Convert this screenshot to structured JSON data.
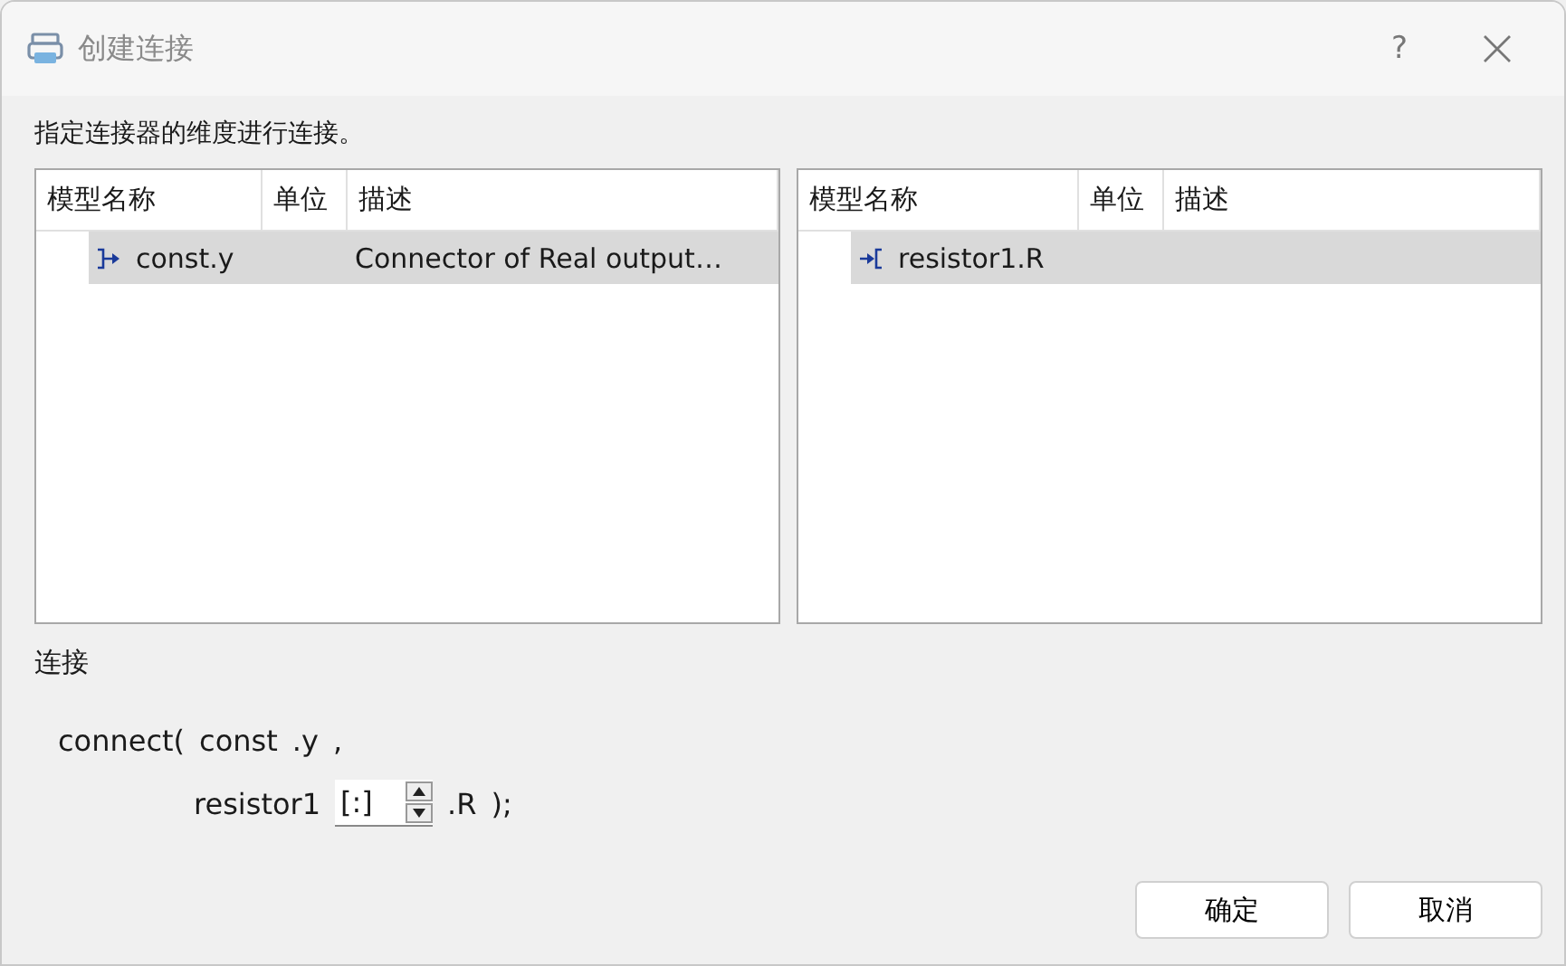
{
  "window": {
    "title": "创建连接",
    "help": "?"
  },
  "instruction": "指定连接器的维度进行连接。",
  "tables": [
    {
      "columns": [
        "模型名称",
        "单位",
        "描述"
      ],
      "rows": [
        {
          "name": "const.y",
          "kind": "output",
          "unit": "",
          "description": "Connector of Real output…",
          "selected": true
        }
      ]
    },
    {
      "columns": [
        "模型名称",
        "单位",
        "描述"
      ],
      "rows": [
        {
          "name": "resistor1.R",
          "kind": "input",
          "unit": "",
          "description": "",
          "selected": true
        }
      ]
    }
  ],
  "connection": {
    "label": "连接",
    "line1": [
      "connect(",
      "const",
      ".y",
      ","
    ],
    "line2_prefix": "resistor1",
    "index_value": "[:]",
    "line2_suffix": [
      ".R",
      ");"
    ]
  },
  "buttons": [
    "确定",
    "取消"
  ]
}
